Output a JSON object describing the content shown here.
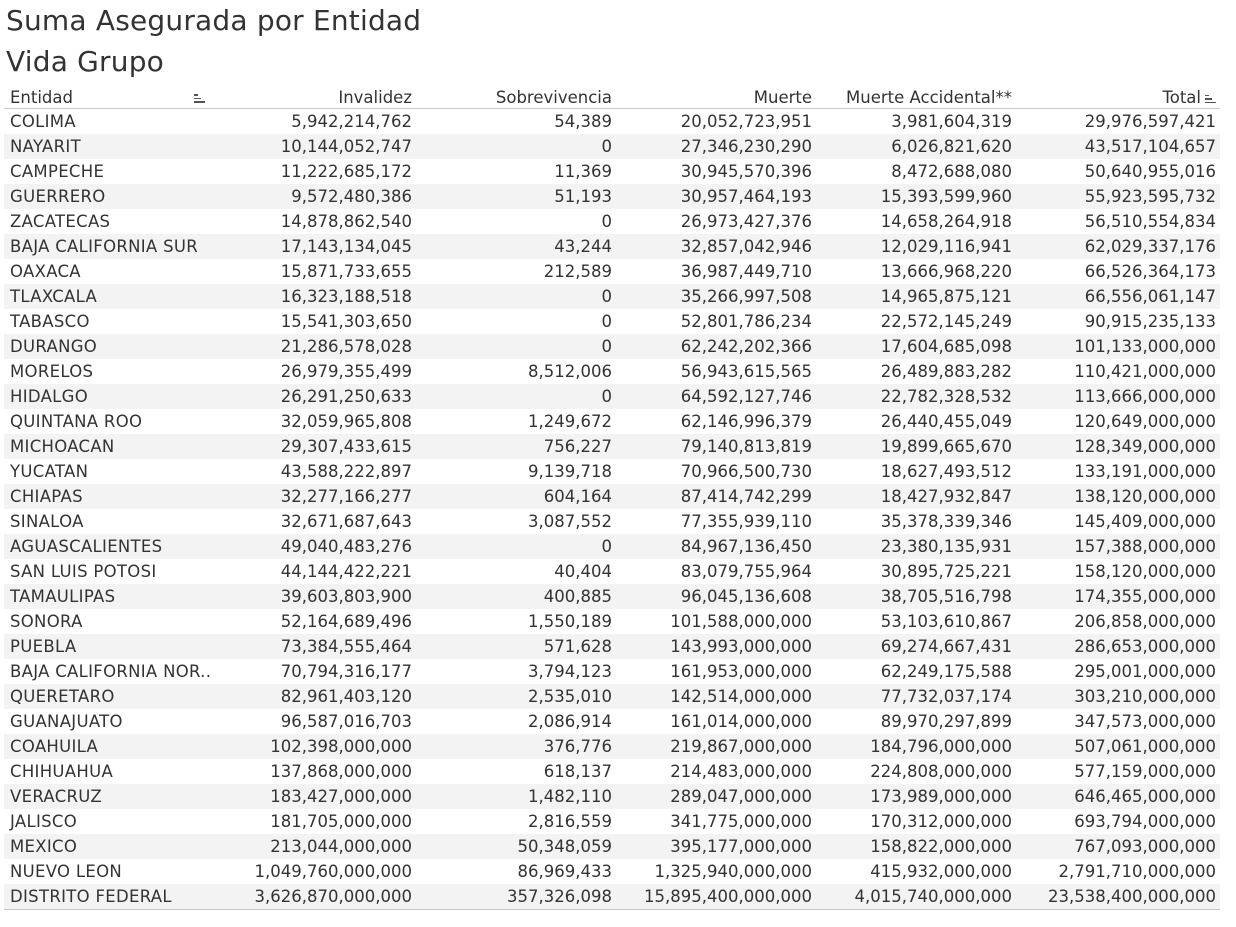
{
  "title": "Suma Asegurada por Entidad",
  "subtitle": "Vida Grupo",
  "chart_data": {
    "type": "table",
    "title": "Suma Asegurada por Entidad",
    "subtitle": "Vida Grupo",
    "columns": [
      "Entidad",
      "Invalidez",
      "Sobrevivencia",
      "Muerte",
      "Muerte Accidental**",
      "Total"
    ],
    "rows": [
      [
        "COLIMA",
        "5,942,214,762",
        "54,389",
        "20,052,723,951",
        "3,981,604,319",
        "29,976,597,421"
      ],
      [
        "NAYARIT",
        "10,144,052,747",
        "0",
        "27,346,230,290",
        "6,026,821,620",
        "43,517,104,657"
      ],
      [
        "CAMPECHE",
        "11,222,685,172",
        "11,369",
        "30,945,570,396",
        "8,472,688,080",
        "50,640,955,016"
      ],
      [
        "GUERRERO",
        "9,572,480,386",
        "51,193",
        "30,957,464,193",
        "15,393,599,960",
        "55,923,595,732"
      ],
      [
        "ZACATECAS",
        "14,878,862,540",
        "0",
        "26,973,427,376",
        "14,658,264,918",
        "56,510,554,834"
      ],
      [
        "BAJA CALIFORNIA SUR",
        "17,143,134,045",
        "43,244",
        "32,857,042,946",
        "12,029,116,941",
        "62,029,337,176"
      ],
      [
        "OAXACA",
        "15,871,733,655",
        "212,589",
        "36,987,449,710",
        "13,666,968,220",
        "66,526,364,173"
      ],
      [
        "TLAXCALA",
        "16,323,188,518",
        "0",
        "35,266,997,508",
        "14,965,875,121",
        "66,556,061,147"
      ],
      [
        "TABASCO",
        "15,541,303,650",
        "0",
        "52,801,786,234",
        "22,572,145,249",
        "90,915,235,133"
      ],
      [
        "DURANGO",
        "21,286,578,028",
        "0",
        "62,242,202,366",
        "17,604,685,098",
        "101,133,000,000"
      ],
      [
        "MORELOS",
        "26,979,355,499",
        "8,512,006",
        "56,943,615,565",
        "26,489,883,282",
        "110,421,000,000"
      ],
      [
        "HIDALGO",
        "26,291,250,633",
        "0",
        "64,592,127,746",
        "22,782,328,532",
        "113,666,000,000"
      ],
      [
        "QUINTANA ROO",
        "32,059,965,808",
        "1,249,672",
        "62,146,996,379",
        "26,440,455,049",
        "120,649,000,000"
      ],
      [
        "MICHOACAN",
        "29,307,433,615",
        "756,227",
        "79,140,813,819",
        "19,899,665,670",
        "128,349,000,000"
      ],
      [
        "YUCATAN",
        "43,588,222,897",
        "9,139,718",
        "70,966,500,730",
        "18,627,493,512",
        "133,191,000,000"
      ],
      [
        "CHIAPAS",
        "32,277,166,277",
        "604,164",
        "87,414,742,299",
        "18,427,932,847",
        "138,120,000,000"
      ],
      [
        "SINALOA",
        "32,671,687,643",
        "3,087,552",
        "77,355,939,110",
        "35,378,339,346",
        "145,409,000,000"
      ],
      [
        "AGUASCALIENTES",
        "49,040,483,276",
        "0",
        "84,967,136,450",
        "23,380,135,931",
        "157,388,000,000"
      ],
      [
        "SAN LUIS POTOSI",
        "44,144,422,221",
        "40,404",
        "83,079,755,964",
        "30,895,725,221",
        "158,120,000,000"
      ],
      [
        "TAMAULIPAS",
        "39,603,803,900",
        "400,885",
        "96,045,136,608",
        "38,705,516,798",
        "174,355,000,000"
      ],
      [
        "SONORA",
        "52,164,689,496",
        "1,550,189",
        "101,588,000,000",
        "53,103,610,867",
        "206,858,000,000"
      ],
      [
        "PUEBLA",
        "73,384,555,464",
        "571,628",
        "143,993,000,000",
        "69,274,667,431",
        "286,653,000,000"
      ],
      [
        "BAJA CALIFORNIA NOR..",
        "70,794,316,177",
        "3,794,123",
        "161,953,000,000",
        "62,249,175,588",
        "295,001,000,000"
      ],
      [
        "QUERETARO",
        "82,961,403,120",
        "2,535,010",
        "142,514,000,000",
        "77,732,037,174",
        "303,210,000,000"
      ],
      [
        "GUANAJUATO",
        "96,587,016,703",
        "2,086,914",
        "161,014,000,000",
        "89,970,297,899",
        "347,573,000,000"
      ],
      [
        "COAHUILA",
        "102,398,000,000",
        "376,776",
        "219,867,000,000",
        "184,796,000,000",
        "507,061,000,000"
      ],
      [
        "CHIHUAHUA",
        "137,868,000,000",
        "618,137",
        "214,483,000,000",
        "224,808,000,000",
        "577,159,000,000"
      ],
      [
        "VERACRUZ",
        "183,427,000,000",
        "1,482,110",
        "289,047,000,000",
        "173,989,000,000",
        "646,465,000,000"
      ],
      [
        "JALISCO",
        "181,705,000,000",
        "2,816,559",
        "341,775,000,000",
        "170,312,000,000",
        "693,794,000,000"
      ],
      [
        "MEXICO",
        "213,044,000,000",
        "50,348,059",
        "395,177,000,000",
        "158,822,000,000",
        "767,093,000,000"
      ],
      [
        "NUEVO LEON",
        "1,049,760,000,000",
        "86,969,433",
        "1,325,940,000,000",
        "415,932,000,000",
        "2,791,710,000,000"
      ],
      [
        "DISTRITO FEDERAL",
        "3,626,870,000,000",
        "357,326,098",
        "15,895,400,000,000",
        "4,015,740,000,000",
        "23,538,400,000,000"
      ]
    ],
    "sort": {
      "column": "Total",
      "order": "ascending"
    }
  },
  "icons": {
    "entidad_sort": "sort-icon",
    "total_sort": "sort-ascending-icon"
  },
  "colors": {
    "text": "#333333",
    "band": "#f3f3f3",
    "rule": "#c8c8c8"
  }
}
